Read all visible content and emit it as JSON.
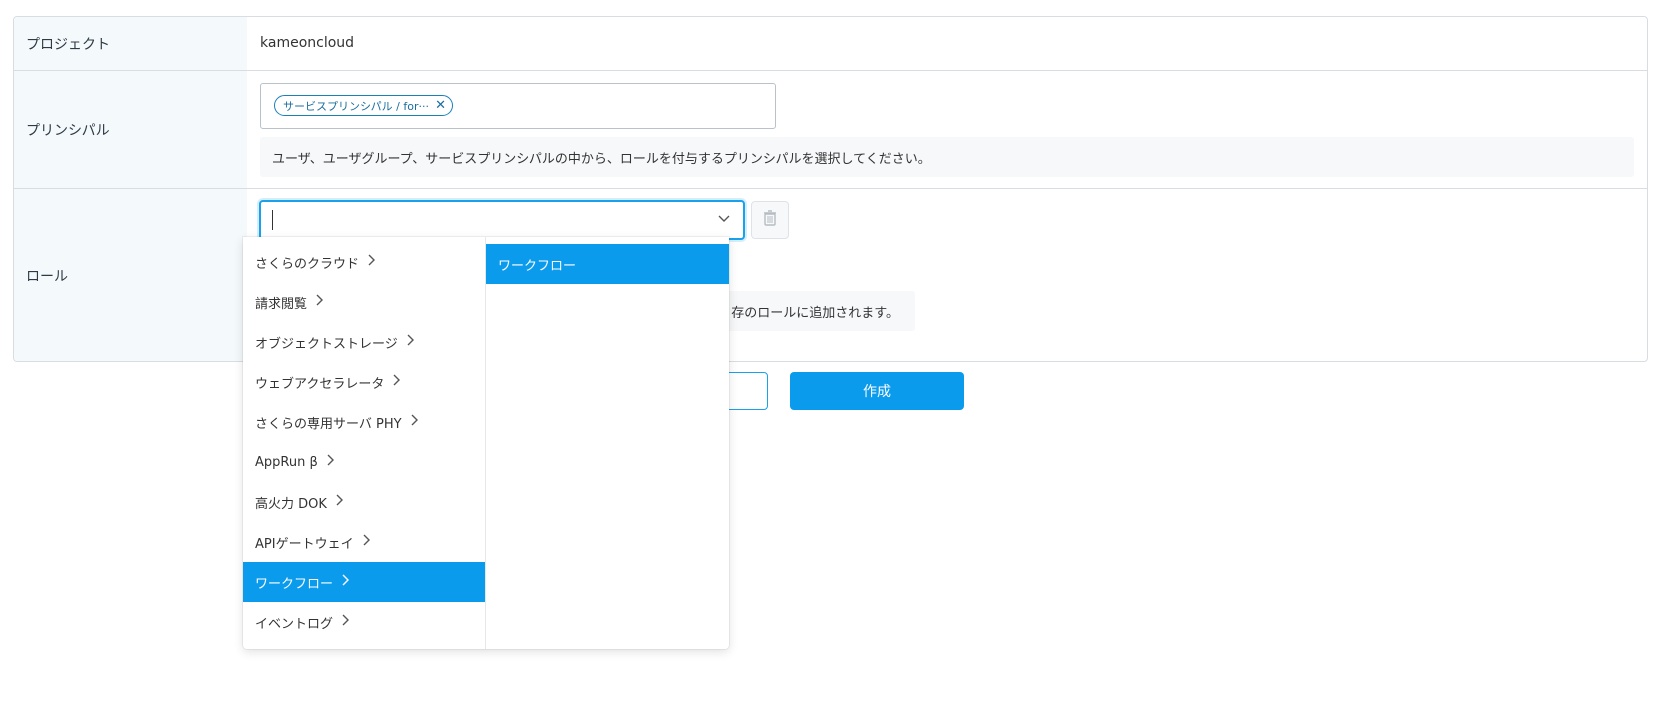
{
  "form": {
    "project": {
      "label": "プロジェクト",
      "value": "kameoncloud"
    },
    "principal": {
      "label": "プリンシパル",
      "chip_text": "サービスプリンシパル / for···",
      "help_text": "ユーザ、ユーザグループ、サービスプリンシパルの中から、ロールを付与するプリンシパルを選択してください。"
    },
    "role": {
      "label": "ロール",
      "select_value": "",
      "note_visible_text": "存のロールに追加されます。"
    }
  },
  "buttons": {
    "cancel_label": "",
    "create_label": "作成"
  },
  "dropdown": {
    "categories": [
      {
        "label": "さくらのクラウド",
        "active": false
      },
      {
        "label": "請求閲覧",
        "active": false
      },
      {
        "label": "オブジェクトストレージ",
        "active": false
      },
      {
        "label": "ウェブアクセラレータ",
        "active": false
      },
      {
        "label": "さくらの専用サーバ PHY",
        "active": false
      },
      {
        "label": "AppRun β",
        "active": false
      },
      {
        "label": "高火力 DOK",
        "active": false
      },
      {
        "label": "APIゲートウェイ",
        "active": false
      },
      {
        "label": "ワークフロー",
        "active": true
      },
      {
        "label": "イベントログ",
        "active": false
      }
    ],
    "roles": [
      {
        "label": "ワークフロー",
        "active": true
      }
    ]
  },
  "icons": {
    "chip_close": "close-icon",
    "select_chevron": "chevron-down-icon",
    "trash": "trash-icon",
    "submenu_arrow": "chevron-right-icon"
  },
  "colors": {
    "accent": "#0b9bec",
    "label_bg": "#f4f9fc",
    "border": "#d9dde2"
  }
}
